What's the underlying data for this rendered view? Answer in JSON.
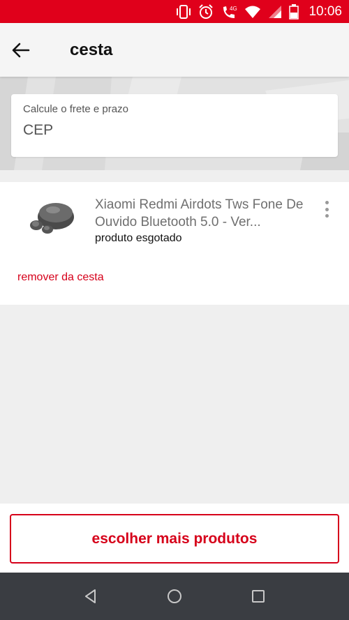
{
  "status_bar": {
    "time": "10:06",
    "network": "4G",
    "icons": [
      "vibrate-icon",
      "alarm-icon",
      "volte-call-icon",
      "wifi-icon",
      "signal-icon",
      "battery-icon"
    ],
    "bg_color": "#e0001b"
  },
  "app_bar": {
    "title": "cesta",
    "back_icon": "arrow-back-icon"
  },
  "cep": {
    "label": "Calcule o frete e prazo",
    "placeholder": "CEP",
    "value": ""
  },
  "cart": {
    "items": [
      {
        "name": "Xiaomi Redmi Airdots Tws Fone De Ouvido Bluetooth 5.0 - Ver...",
        "status": "produto esgotado",
        "remove_label": "remover da cesta",
        "image": "earbuds-product-image",
        "menu_icon": "more-vert-icon"
      }
    ]
  },
  "cta": {
    "label": "escolher mais produtos"
  },
  "nav_bar": {
    "buttons": [
      "back-triangle-icon",
      "home-circle-icon",
      "recents-square-icon"
    ]
  },
  "colors": {
    "accent": "#d6001a",
    "background": "#efefef"
  }
}
